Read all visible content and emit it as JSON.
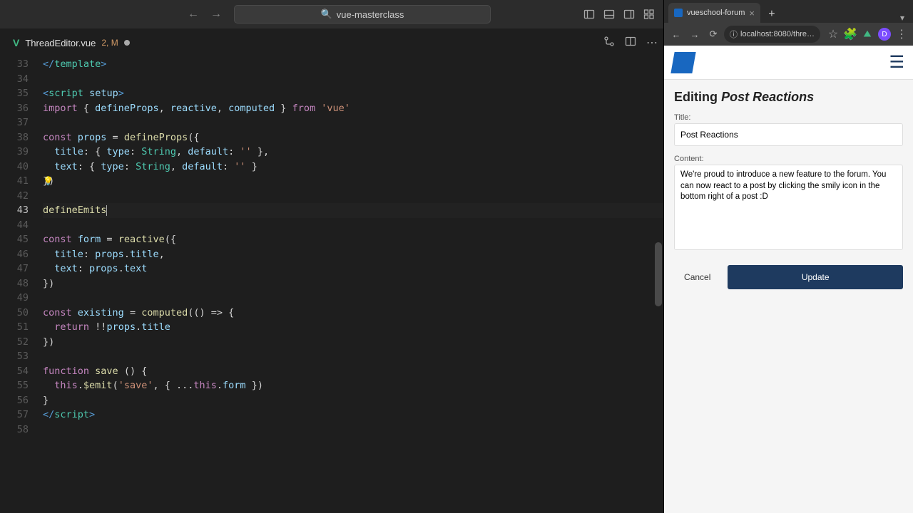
{
  "editor": {
    "project_name": "vue-masterclass",
    "tab": {
      "filename": "ThreadEditor.vue",
      "badge": "2, M"
    },
    "gutter_start": 33,
    "lines": [
      {
        "n": 33,
        "html": "<span class='tag'>&lt;/</span><span class='tagname'>template</span><span class='tag'>&gt;</span>"
      },
      {
        "n": 34,
        "html": ""
      },
      {
        "n": 35,
        "html": "<span class='tag'>&lt;</span><span class='tagname'>script</span> <span class='attr'>setup</span><span class='tag'>&gt;</span>"
      },
      {
        "n": 36,
        "html": "<span class='kw'>import</span> { <span class='var'>defineProps</span>, <span class='var'>reactive</span>, <span class='var'>computed</span> } <span class='kw'>from</span> <span class='str'>'vue'</span>"
      },
      {
        "n": 37,
        "html": ""
      },
      {
        "n": 38,
        "html": "<span class='kw'>const</span> <span class='var'>props</span> = <span class='fn'>defineProps</span>({"
      },
      {
        "n": 39,
        "html": "  <span class='prop'>title</span>: { <span class='prop'>type</span>: <span class='type'>String</span>, <span class='prop'>default</span>: <span class='str'>''</span> },"
      },
      {
        "n": 40,
        "html": "  <span class='prop'>text</span>: { <span class='prop'>type</span>: <span class='type'>String</span>, <span class='prop'>default</span>: <span class='str'>''</span> }"
      },
      {
        "n": 41,
        "html": "})"
      },
      {
        "n": 42,
        "html": ""
      },
      {
        "n": 43,
        "html": "<span class='fn'>defineEmits</span><span class='cursor-bar'></span>",
        "cursor": true
      },
      {
        "n": 44,
        "html": ""
      },
      {
        "n": 45,
        "html": "<span class='kw'>const</span> <span class='var'>form</span> = <span class='fn'>reactive</span>({"
      },
      {
        "n": 46,
        "html": "  <span class='prop'>title</span>: <span class='var'>props</span>.<span class='prop'>title</span>,"
      },
      {
        "n": 47,
        "html": "  <span class='prop'>text</span>: <span class='var'>props</span>.<span class='prop'>text</span>"
      },
      {
        "n": 48,
        "html": "})"
      },
      {
        "n": 49,
        "html": ""
      },
      {
        "n": 50,
        "html": "<span class='kw'>const</span> <span class='var'>existing</span> = <span class='fn'>computed</span>(() <span class='op'>=&gt;</span> {"
      },
      {
        "n": 51,
        "html": "  <span class='kw'>return</span> !!<span class='var'>props</span>.<span class='prop'>title</span>"
      },
      {
        "n": 52,
        "html": "})"
      },
      {
        "n": 53,
        "html": ""
      },
      {
        "n": 54,
        "html": "<span class='kw'>function</span> <span class='fn'>save</span> () {"
      },
      {
        "n": 55,
        "html": "  <span class='kw'>this</span>.<span class='fn'>$emit</span>(<span class='str'>'save'</span>, { ...<span class='kw'>this</span>.<span class='var'>form</span> })"
      },
      {
        "n": 56,
        "html": "}"
      },
      {
        "n": 57,
        "html": "<span class='tag'>&lt;/</span><span class='tagname'>script</span><span class='tag'>&gt;</span>"
      },
      {
        "n": 58,
        "html": ""
      }
    ]
  },
  "browser": {
    "tab_title": "vueschool-forum",
    "url": "localhost:8080/thre…",
    "page": {
      "heading_prefix": "Editing",
      "heading_italic": "Post Reactions",
      "title_label": "Title:",
      "title_value": "Post Reactions",
      "content_label": "Content:",
      "content_value": "We're proud to introduce a new feature to the forum. You can now react to a post by clicking the smily icon in the bottom right of a post :D",
      "cancel": "Cancel",
      "update": "Update"
    }
  }
}
